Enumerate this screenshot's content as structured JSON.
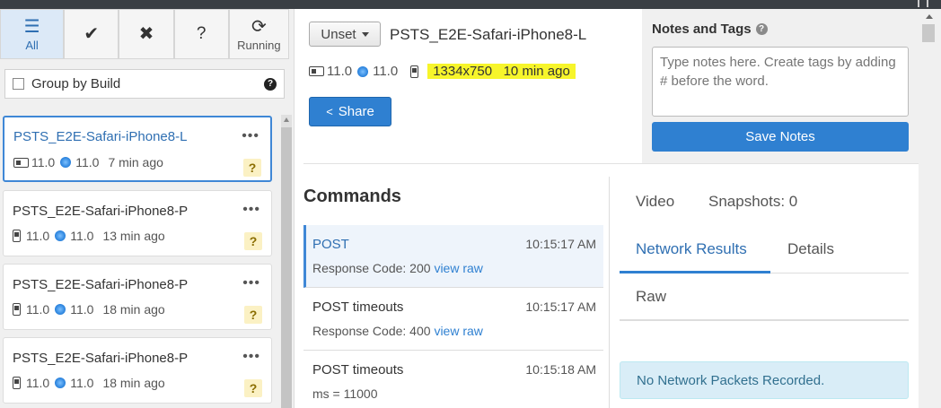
{
  "filters": [
    {
      "label": "All",
      "icon": "list-icon",
      "active": true
    },
    {
      "label": "",
      "icon": "check-icon"
    },
    {
      "label": "",
      "icon": "x-icon"
    },
    {
      "label": "",
      "icon": "question-icon"
    },
    {
      "label": "Running",
      "icon": "refresh-icon"
    }
  ],
  "group": {
    "label": "Group by Build",
    "help": "?"
  },
  "builds": [
    {
      "name": "PSTS_E2E-Safari-iPhone8-L",
      "device": "landscape",
      "os": "11.0",
      "browser": "11.0",
      "time": "7 min ago",
      "status": "?"
    },
    {
      "name": "PSTS_E2E-Safari-iPhone8-P",
      "device": "portrait",
      "os": "11.0",
      "browser": "11.0",
      "time": "13 min ago",
      "status": "?"
    },
    {
      "name": "PSTS_E2E-Safari-iPhone8-P",
      "device": "portrait",
      "os": "11.0",
      "browser": "11.0",
      "time": "18 min ago",
      "status": "?"
    },
    {
      "name": "PSTS_E2E-Safari-iPhone8-P",
      "device": "portrait",
      "os": "11.0",
      "browser": "11.0",
      "time": "18 min ago",
      "status": "?"
    }
  ],
  "header": {
    "status_select": "Unset",
    "title": "PSTS_E2E-Safari-iPhone8-L",
    "os": "11.0",
    "browser": "11.0",
    "resolution_time": "1334x750   10 min ago",
    "share": "Share"
  },
  "notes": {
    "title": "Notes and Tags",
    "help": "?",
    "placeholder": "Type notes here. Create tags by adding # before the word.",
    "save": "Save Notes"
  },
  "commands": {
    "title": "Commands",
    "items": [
      {
        "title": "POST",
        "time": "10:15:17 AM",
        "detail": "Response Code: 200",
        "link": "view raw"
      },
      {
        "title": "POST timeouts",
        "time": "10:15:17 AM",
        "detail": "Response Code: 400",
        "link": "view raw"
      },
      {
        "title": "POST timeouts",
        "time": "10:15:18 AM",
        "detail": "ms = 11000",
        "link": ""
      }
    ]
  },
  "tabs": {
    "video": "Video",
    "snapshots": "Snapshots: 0",
    "network": "Network Results",
    "details": "Details",
    "raw": "Raw"
  },
  "alert": "No Network Packets Recorded.",
  "colors": {
    "accent": "#2f80d1",
    "highlight": "#f7f52b",
    "alert_bg": "#d9edf7"
  }
}
